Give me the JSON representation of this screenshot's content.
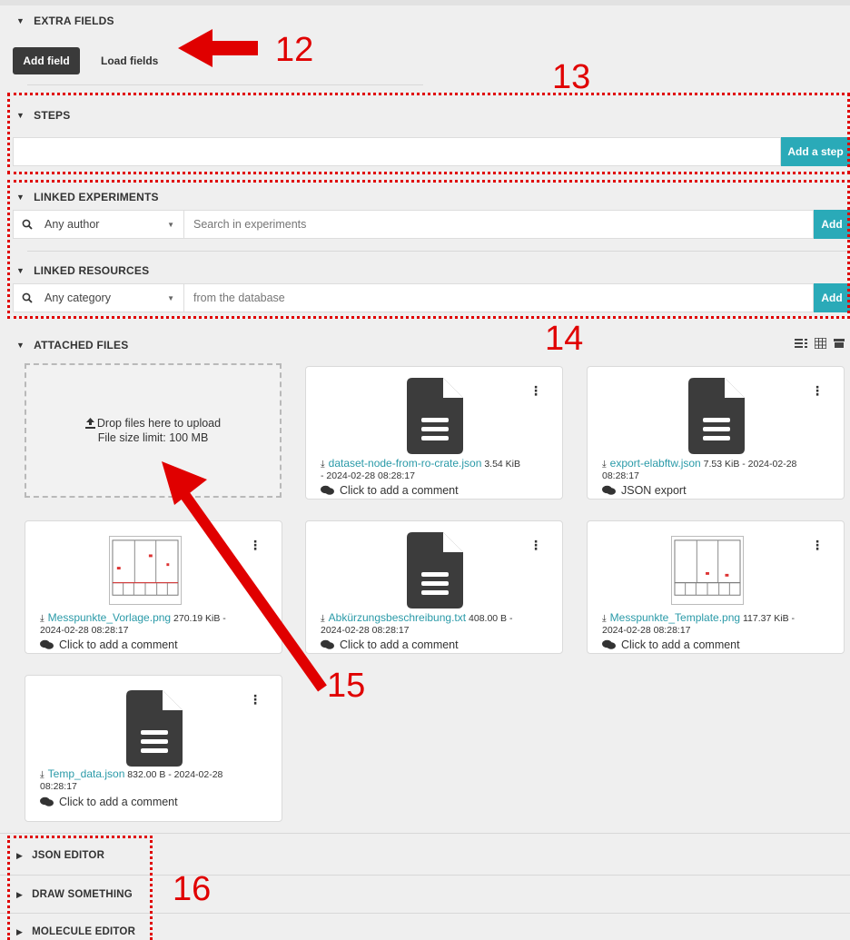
{
  "extra_fields": {
    "title": "EXTRA FIELDS",
    "add_field": "Add field",
    "load_fields": "Load fields"
  },
  "steps": {
    "title": "STEPS",
    "input_value": "",
    "add_step": "Add a step"
  },
  "linked_experiments": {
    "title": "LINKED EXPERIMENTS",
    "select_value": "Any author",
    "placeholder": "Search in experiments",
    "add": "Add"
  },
  "linked_resources": {
    "title": "LINKED RESOURCES",
    "select_value": "Any category",
    "placeholder": "from the database",
    "add": "Add"
  },
  "attached_files": {
    "title": "ATTACHED FILES",
    "upload_line1": "Drop files here to upload",
    "upload_line2": "File size limit: 100 MB",
    "files": [
      {
        "name": "dataset-node-from-ro-crate.json",
        "info_a": " 3.54 KiB",
        "info_b": "- 2024-02-28 08:28:17",
        "comment": "Click to add a comment",
        "kind": "doc"
      },
      {
        "name": "export-elabftw.json",
        "info_a": " 7.53 KiB - 2024-02-28",
        "info_b": "08:28:17",
        "comment": "JSON export",
        "kind": "doc"
      },
      {
        "name": "Messpunkte_Vorlage.png",
        "info_a": " 270.19 KiB -",
        "info_b": "2024-02-28 08:28:17",
        "comment": "Click to add a comment",
        "kind": "image"
      },
      {
        "name": "Abkürzungsbeschreibung.txt",
        "info_a": " 408.00 B -",
        "info_b": "2024-02-28 08:28:17",
        "comment": "Click to add a comment",
        "kind": "doc"
      },
      {
        "name": "Messpunkte_Template.png",
        "info_a": " 117.37 KiB -",
        "info_b": "2024-02-28 08:28:17",
        "comment": "Click to add a comment",
        "kind": "image"
      },
      {
        "name": "Temp_data.json",
        "info_a": " 832.00 B - 2024-02-28",
        "info_b": "08:28:17",
        "comment": "Click to add a comment",
        "kind": "doc"
      }
    ]
  },
  "collapsed": {
    "json_editor": "JSON EDITOR",
    "draw_something": "DRAW SOMETHING",
    "molecule_editor": "MOLECULE EDITOR"
  },
  "annotations": {
    "n12": "12",
    "n13": "13",
    "n14": "14",
    "n15": "15",
    "n16": "16"
  },
  "colors": {
    "accent": "#2aaab8",
    "annotation": "#e00000",
    "dark_button": "#3a3a3a"
  },
  "icons": [
    "caret-down-icon",
    "caret-right-icon",
    "search-icon",
    "chevron-down-icon",
    "upload-icon",
    "file-icon",
    "download-icon",
    "comments-icon",
    "kebab-icon",
    "list-view-icon",
    "grid-view-icon",
    "archive-icon"
  ]
}
